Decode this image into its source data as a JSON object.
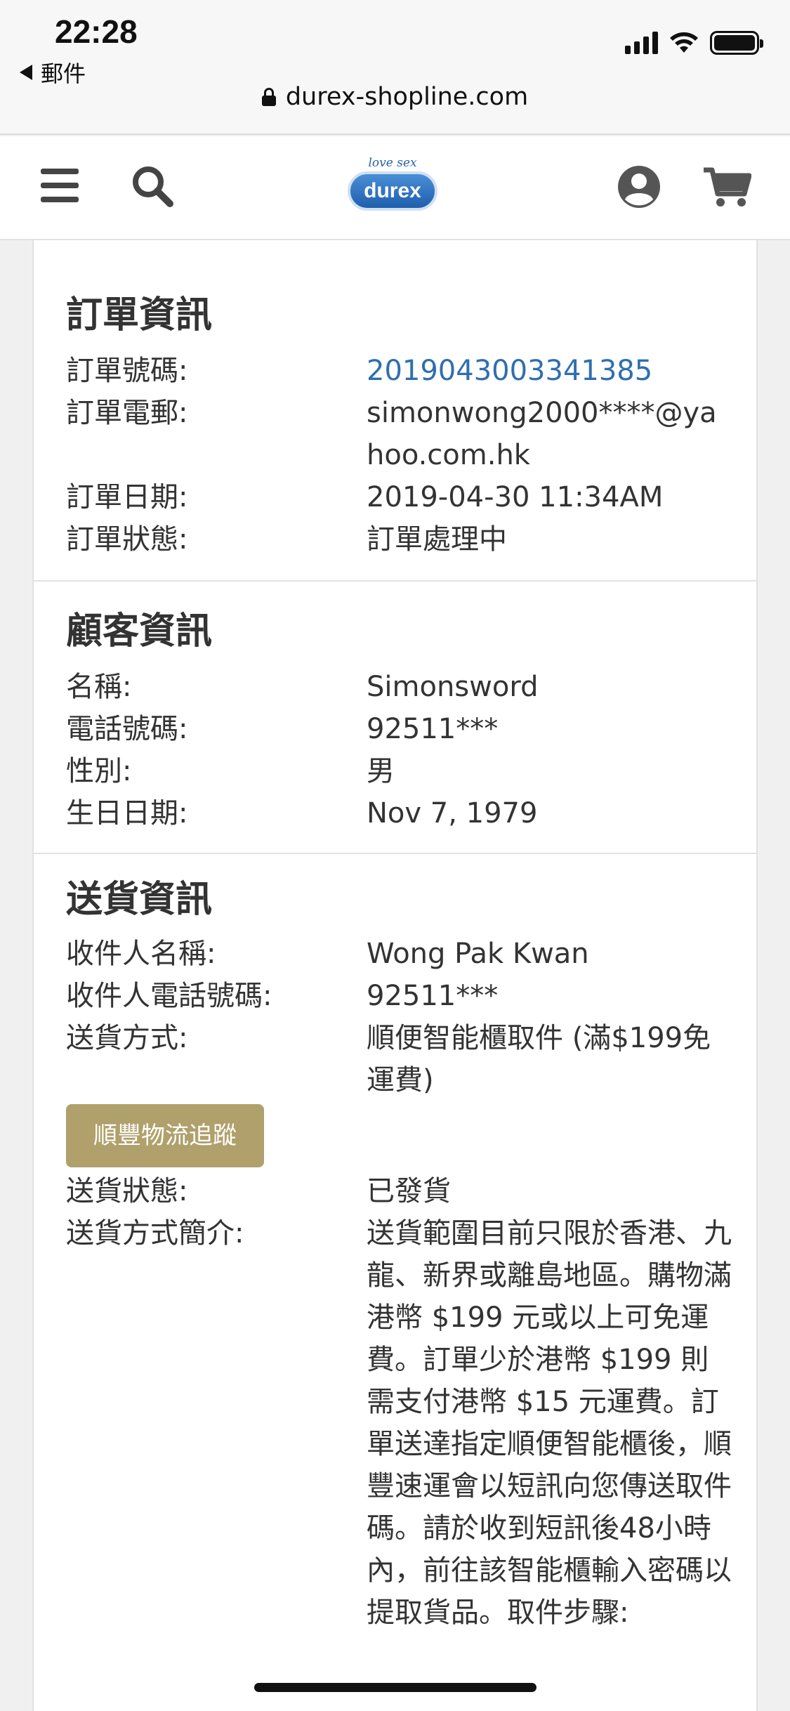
{
  "status_bar": {
    "time": "22:28",
    "back_app": "郵件"
  },
  "browser": {
    "url": "durex-shopline.com"
  },
  "header": {
    "logo_tagline": "love sex",
    "logo_text": "durex"
  },
  "order_info": {
    "title": "訂單資訊",
    "rows": [
      {
        "label": "訂單號碼:",
        "value": "2019043003341385"
      },
      {
        "label": "訂單電郵:",
        "value": "simonwong2000****@yahoo.com.hk"
      },
      {
        "label": "訂單日期:",
        "value": "2019-04-30 11:34AM"
      },
      {
        "label": "訂單狀態:",
        "value": "訂單處理中"
      }
    ]
  },
  "customer_info": {
    "title": "顧客資訊",
    "rows": [
      {
        "label": "名稱:",
        "value": "Simonsword"
      },
      {
        "label": "電話號碼:",
        "value": "92511***"
      },
      {
        "label": "性別:",
        "value": "男"
      },
      {
        "label": "生日日期:",
        "value": "Nov 7, 1979"
      }
    ]
  },
  "delivery_info": {
    "title": "送貨資訊",
    "rows": [
      {
        "label": "收件人名稱:",
        "value": "Wong Pak Kwan"
      },
      {
        "label": "收件人電話號碼:",
        "value": "92511***"
      },
      {
        "label": "送貨方式:",
        "value": "順便智能櫃取件 (滿$199免運費)"
      }
    ],
    "track_button": "順豐物流追蹤",
    "status_label": "送貨狀態:",
    "status_value": "已發貨",
    "intro_label": "送貨方式簡介:",
    "intro_text": "送貨範圍目前只限於香港、九龍、新界或離島地區。購物滿港幣 $199 元或以上可免運費。訂單少於港幣 $199 則需支付港幣 $15 元運費。訂單送達指定順便智能櫃後，順豐速運會以短訊向您傳送取件碼。請於收到短訊後48小時內，前往該智能櫃輸入密碼以提取貨品。取件步驟:"
  }
}
